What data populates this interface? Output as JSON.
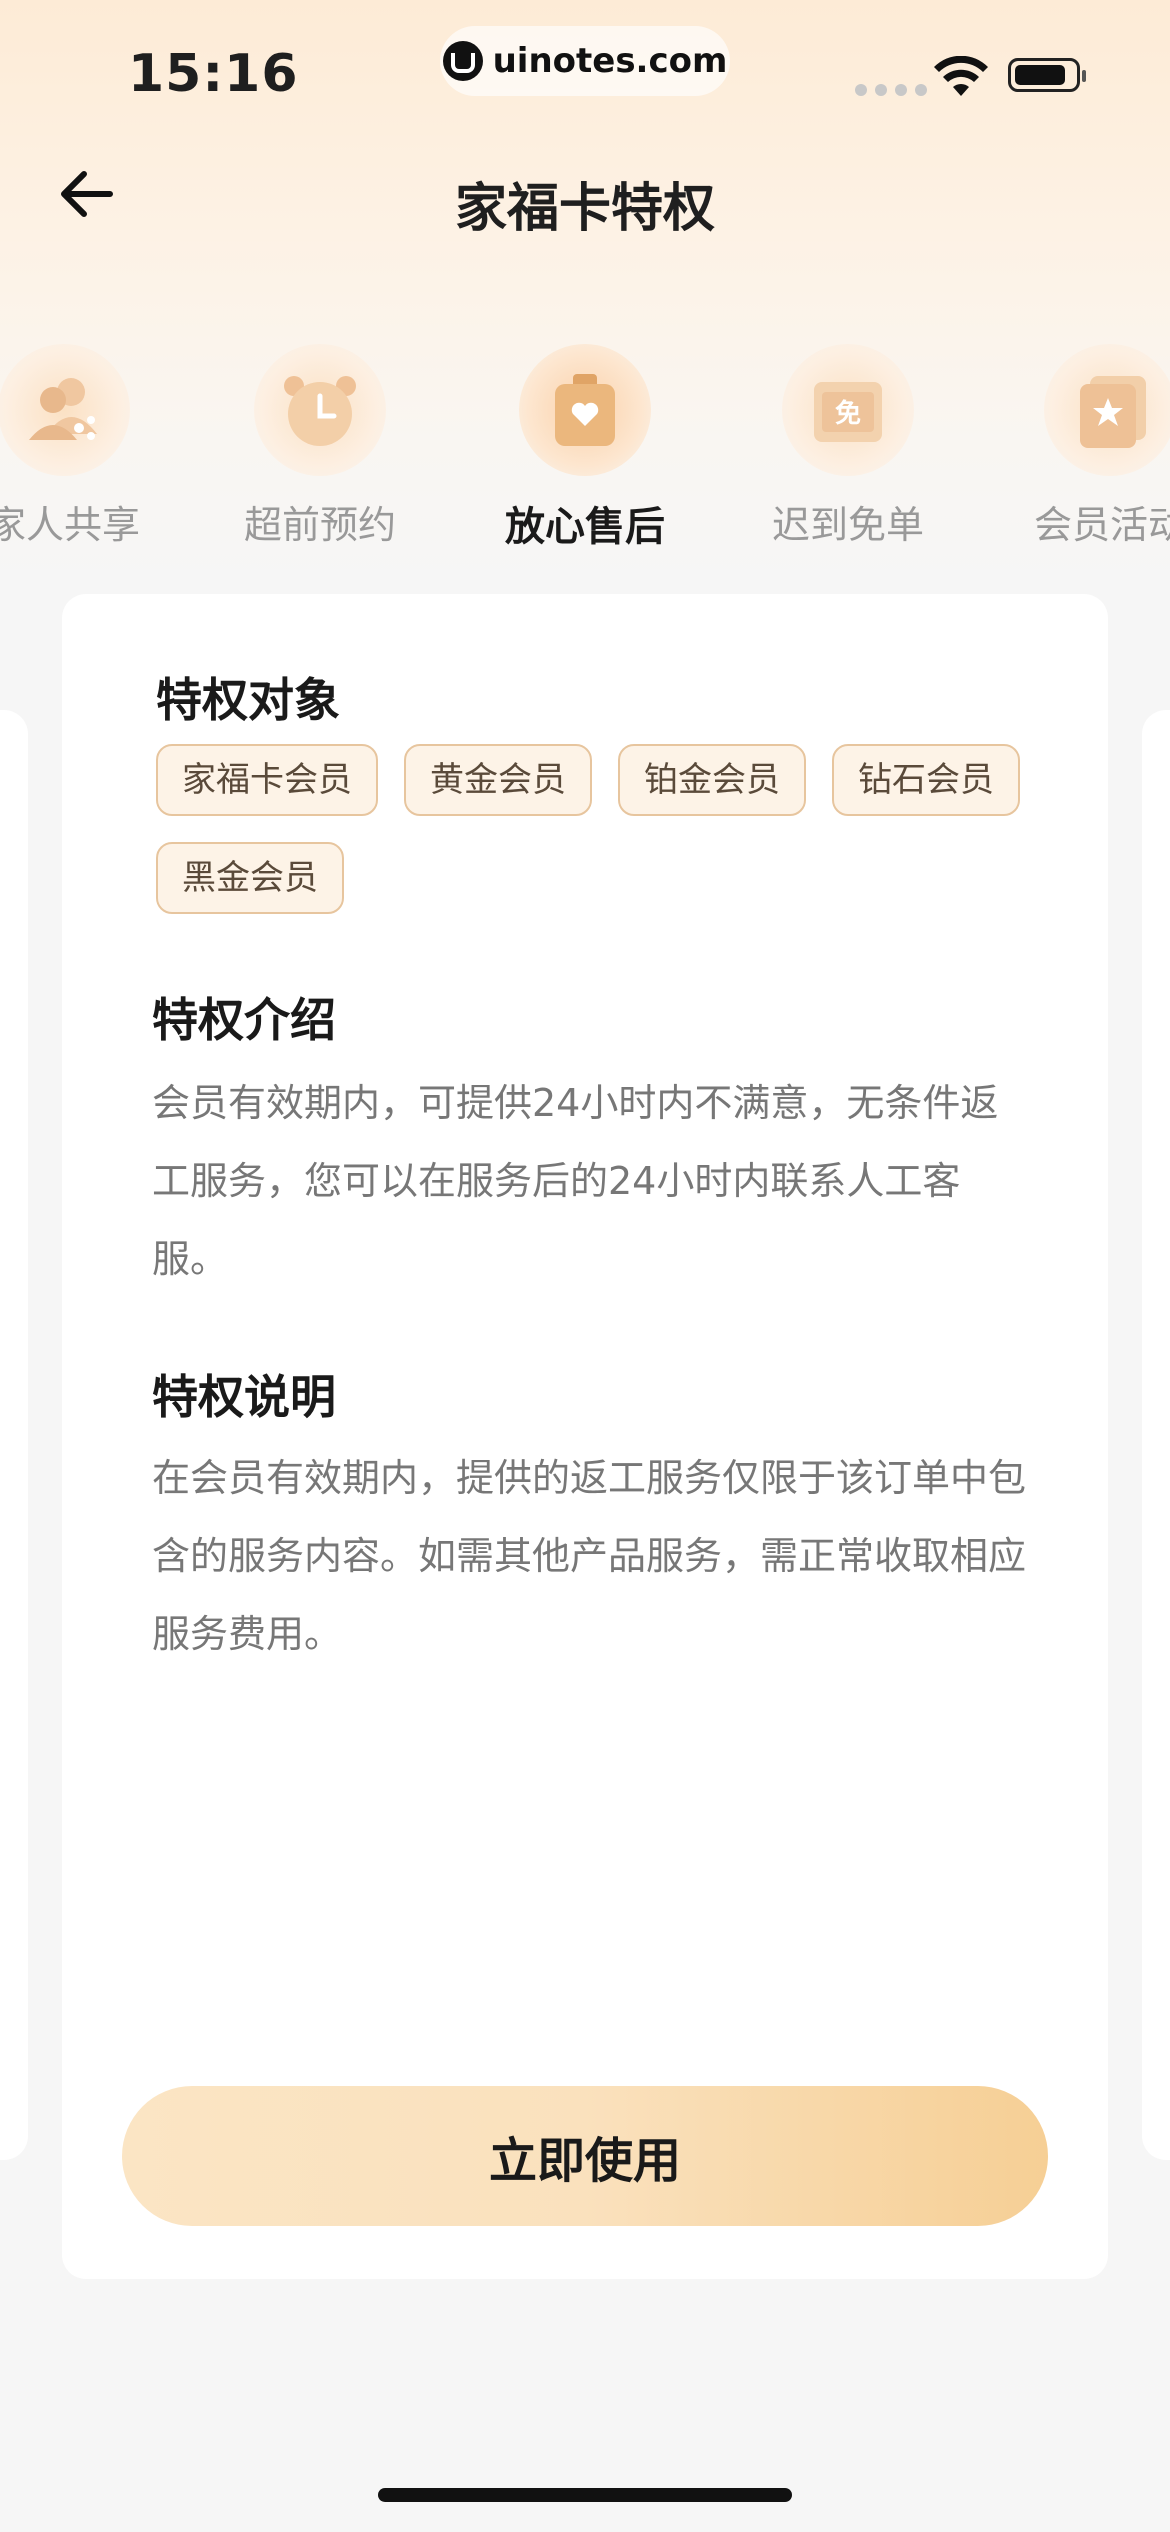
{
  "status_bar": {
    "time": "15:16",
    "url": "uinotes.com"
  },
  "header": {
    "title": "家福卡特权"
  },
  "tabs": [
    {
      "label": "家人共享",
      "icon": "share-people-icon",
      "active": false
    },
    {
      "label": "超前预约",
      "icon": "alarm-clock-icon",
      "active": false
    },
    {
      "label": "放心售后",
      "icon": "heart-bag-icon",
      "active": true
    },
    {
      "label": "迟到免单",
      "icon": "free-coupon-icon",
      "active": false
    },
    {
      "label": "会员活动",
      "icon": "star-flag-icon",
      "active": false
    }
  ],
  "card": {
    "target": {
      "title": "特权对象",
      "tags": [
        "家福卡会员",
        "黄金会员",
        "铂金会员",
        "钻石会员",
        "黑金会员"
      ]
    },
    "intro": {
      "title": "特权介绍",
      "text": "会员有效期内，可提供24小时内不满意，无条件返工服务，您可以在服务后的24小时内联系人工客服。"
    },
    "desc": {
      "title": "特权说明",
      "text": "在会员有效期内，提供的返工服务仅限于该订单中包含的服务内容。如需其他产品服务，需正常收取相应服务费用。"
    },
    "button_label": "立即使用"
  },
  "colors": {
    "accent": "#f6cf95",
    "tag_border": "#e7c59e",
    "tag_bg": "#fdf3e7"
  }
}
